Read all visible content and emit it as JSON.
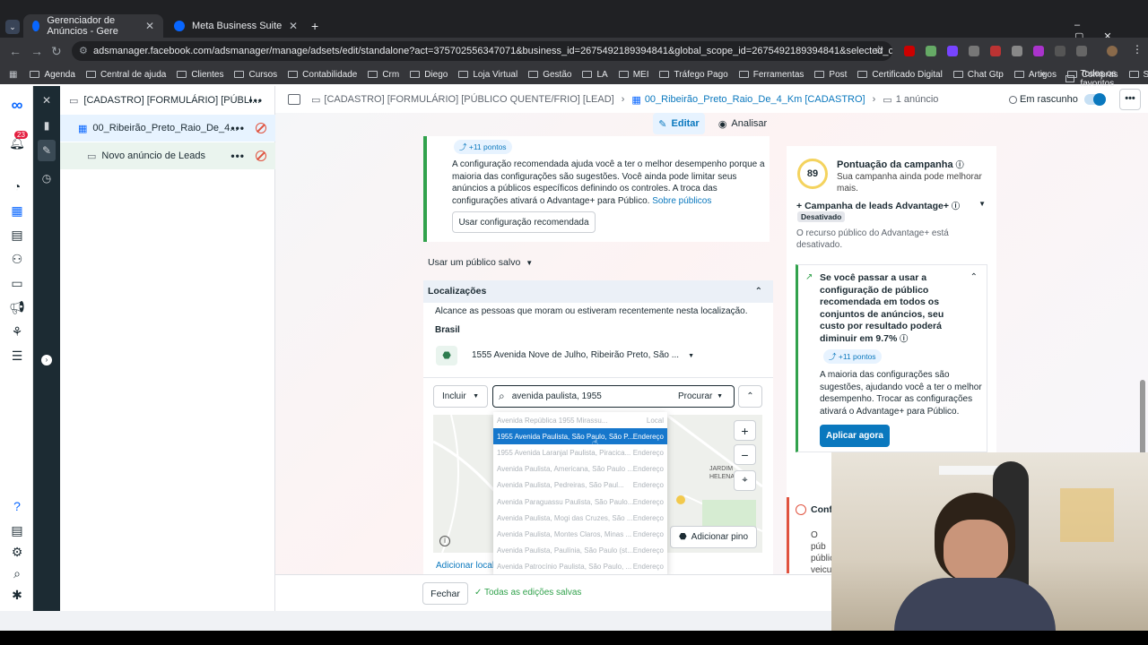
{
  "browser": {
    "tabs": [
      {
        "label": "Gerenciador de Anúncios - Gere"
      },
      {
        "label": "Meta Business Suite"
      }
    ],
    "url": "adsmanager.facebook.com/adsmanager/manage/adsets/edit/standalone?act=375702556347071&business_id=2675492189394841&global_scope_id=2675492189394841&selected_campaign_ids=12023877...",
    "bookmarks": [
      "Agenda",
      "Central de ajuda",
      "Clientes",
      "Cursos",
      "Contabilidade",
      "Crm",
      "Diego",
      "Loja Virtual",
      "Gestão",
      "LA",
      "MEI",
      "Tráfego Pago",
      "Ferramentas",
      "Post",
      "Certificado Digital",
      "Chat Gtp",
      "Artigos",
      "Compras",
      "Seo"
    ],
    "bookmarks_more": "»",
    "all_bookmarks": "Todos os favoritos"
  },
  "rail": {
    "notif_count": "23"
  },
  "tree": {
    "campaign": "[CADASTRO] [FORMULÁRIO] [PÚBLI...",
    "adset": "00_Ribeirão_Preto_Raio_De_4...",
    "ad": "Novo anúncio de Leads"
  },
  "topbar": {
    "crumb1": "[CADASTRO] [FORMULÁRIO] [PÚBLICO QUENTE/FRIO] [LEAD]",
    "crumb2": "00_Ribeirão_Preto_Raio_De_4_Km [CADASTRO]",
    "crumb3": "1 anúncio",
    "status": "Em rascunho",
    "edit": "Editar",
    "review": "Analisar"
  },
  "recommend": {
    "points": "+11 pontos",
    "text": "A configuração recomendada ajuda você a ter o melhor desempenho porque a maioria das configurações são sugestões. Você ainda pode limitar seus anúncios a públicos específicos definindo os controles. A troca das configurações ativará o Advantage+ para Público.",
    "link": "Sobre públicos",
    "button": "Usar configuração recomendada"
  },
  "saved_audience": "Usar um público salvo",
  "locations": {
    "title": "Localizações",
    "desc": "Alcance as pessoas que moram ou estiveram recentemente nesta localização.",
    "country": "Brasil",
    "pin": "1555 Avenida Nove de Julho, Ribeirão Preto, São ...",
    "include": "Incluir",
    "search_value": "avenida paulista, 1955",
    "search_type": "Procurar",
    "add_pin": "Adicionar pino",
    "add_locations": "Adicionar locali",
    "map_label": "JARDIM HELENA",
    "suggestions": [
      {
        "name": "Avenida República 1955 Mirassu...",
        "type": "Local"
      },
      {
        "name": "1955 Avenida Paulista, São Paulo, São P...",
        "type": "Endereço"
      },
      {
        "name": "1955 Avenida Laranjal Paulista, Piracica...",
        "type": "Endereço"
      },
      {
        "name": "Avenida Paulista, Americana, São Paulo ...",
        "type": "Endereço"
      },
      {
        "name": "Avenida Paulista, Pedreiras, São Paul...",
        "type": "Endereço"
      },
      {
        "name": "Avenida Paraguassu Paulista, São Paulo...",
        "type": "Endereço"
      },
      {
        "name": "Avenida Paulista, Mogi das Cruzes, São ...",
        "type": "Endereço"
      },
      {
        "name": "Avenida Paulista, Montes Claros, Minas ...",
        "type": "Endereço"
      },
      {
        "name": "Avenida Paulista, Paulínia, São Paulo (st...",
        "type": "Endereço"
      },
      {
        "name": "Avenida Patrocínio Paulista, São Paulo, ...",
        "type": "Endereço"
      }
    ]
  },
  "score": {
    "value": "89",
    "title": "Pontuação da campanha",
    "sub": "Sua campanha ainda pode melhorar mais.",
    "advantage": "Campanha de leads Advantage+",
    "badge": "Desativado",
    "adv_desc": "O recurso público do Advantage+ está desativado.",
    "tip_title": "Se você passar a usar a configuração de público recomendada em todos os conjuntos de anúncios, seu custo por resultado poderá diminuir em 9.7%",
    "tip_points": "+11 pontos",
    "tip_text": "A maioria das configurações são sugestões, ajudando você a ter o melhor desempenho. Trocar as configurações ativará o Advantage+ para Público.",
    "apply": "Aplicar agora",
    "conf": "Conf",
    "conf_text": "O púb públic veicu"
  },
  "bottom": {
    "close": "Fechar",
    "saved": "Todas as edições salvas"
  },
  "colors": {
    "accent": "#0a78be",
    "green": "#31a24c",
    "meta_blue": "#0866ff"
  }
}
